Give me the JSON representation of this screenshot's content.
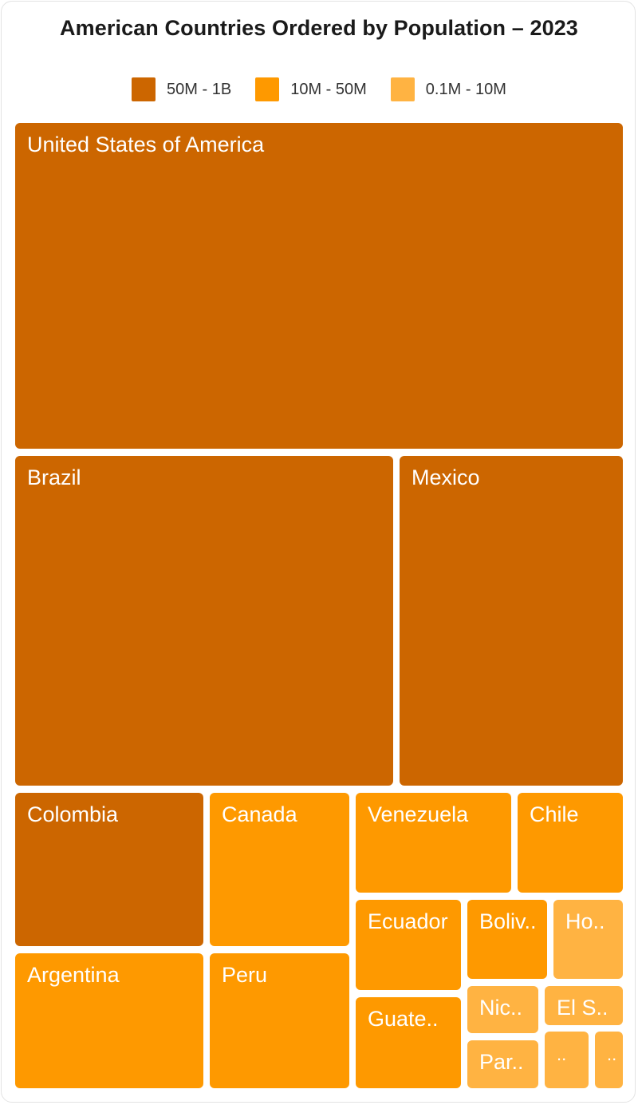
{
  "title": "American Countries Ordered by Population – 2023",
  "legend": [
    {
      "label": "50M - 1B",
      "color": "#cc6600"
    },
    {
      "label": "10M - 50M",
      "color": "#fe9900"
    },
    {
      "label": "0.1M - 10M",
      "color": "#ffb342"
    }
  ],
  "chart_data": {
    "type": "treemap",
    "title": "American Countries Ordered by Population – 2023",
    "items": [
      {
        "name": "United States of America",
        "label": "United States of America",
        "group": "50M - 1B"
      },
      {
        "name": "Brazil",
        "label": "Brazil",
        "group": "50M - 1B"
      },
      {
        "name": "Mexico",
        "label": "Mexico",
        "group": "50M - 1B"
      },
      {
        "name": "Colombia",
        "label": "Colombia",
        "group": "50M - 1B"
      },
      {
        "name": "Argentina",
        "label": "Argentina",
        "group": "10M - 50M"
      },
      {
        "name": "Canada",
        "label": "Canada",
        "group": "10M - 50M"
      },
      {
        "name": "Peru",
        "label": "Peru",
        "group": "10M - 50M"
      },
      {
        "name": "Venezuela",
        "label": "Venezuela",
        "group": "10M - 50M"
      },
      {
        "name": "Chile",
        "label": "Chile",
        "group": "10M - 50M"
      },
      {
        "name": "Ecuador",
        "label": "Ecuador",
        "group": "10M - 50M"
      },
      {
        "name": "Guatemala",
        "label": "Guate..",
        "group": "10M - 50M"
      },
      {
        "name": "Bolivia",
        "label": "Boliv..",
        "group": "10M - 50M"
      },
      {
        "name": "Honduras",
        "label": "Ho..",
        "group": "0.1M - 10M"
      },
      {
        "name": "Nicaragua",
        "label": "Nic..",
        "group": "0.1M - 10M"
      },
      {
        "name": "El Salvador",
        "label": "El S..",
        "group": "0.1M - 10M"
      },
      {
        "name": "Paraguay",
        "label": "Par..",
        "group": "0.1M - 10M"
      },
      {
        "name": "",
        "label": "..",
        "group": "0.1M - 10M"
      },
      {
        "name": "",
        "label": "..",
        "group": "0.1M - 10M"
      }
    ]
  }
}
